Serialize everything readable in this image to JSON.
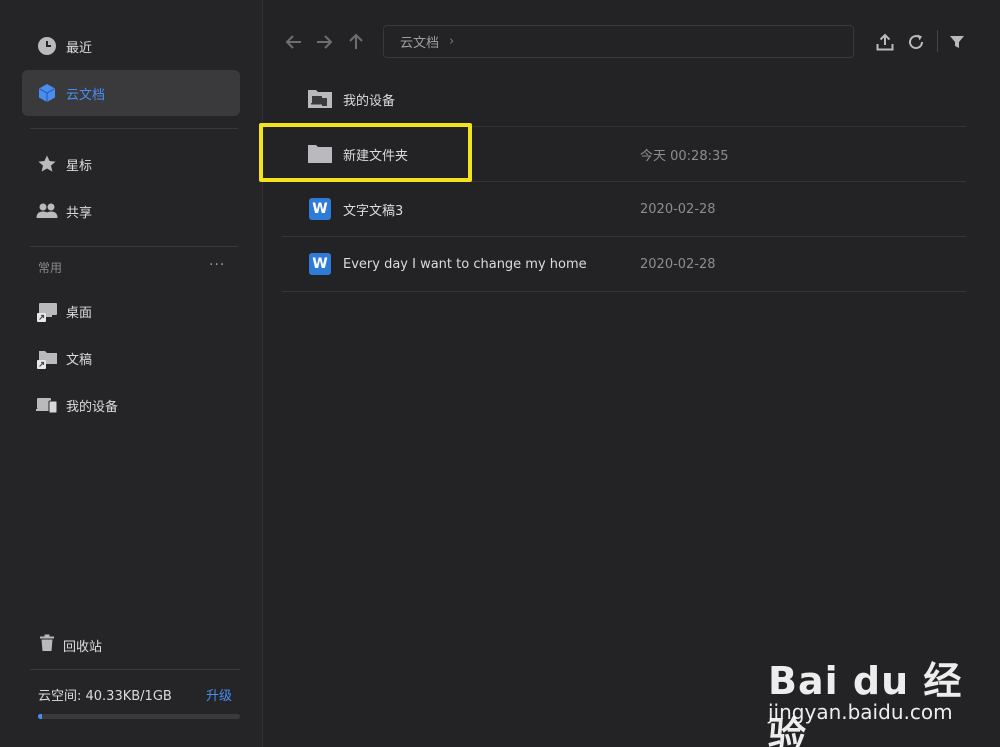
{
  "sidebar": {
    "nav": [
      {
        "label": "最近",
        "icon": "clock-icon"
      },
      {
        "label": "云文档",
        "icon": "cube-icon",
        "active": true
      },
      {
        "label": "星标",
        "icon": "star-icon"
      },
      {
        "label": "共享",
        "icon": "people-icon"
      }
    ],
    "section_title": "常用",
    "section_more": "···",
    "favorites": [
      {
        "label": "桌面",
        "icon": "desktop-shortcut-icon"
      },
      {
        "label": "文稿",
        "icon": "folder-shortcut-icon"
      },
      {
        "label": "我的设备",
        "icon": "devices-icon"
      }
    ],
    "trash_label": "回收站",
    "storage_text": "云空间: 40.33KB/1GB",
    "upgrade_label": "升级",
    "storage_used_fraction": 0.02
  },
  "toolbar": {
    "breadcrumb": "云文档",
    "breadcrumb_chevron": "›"
  },
  "files": [
    {
      "name": "我的设备",
      "date": "",
      "icon": "devices-folder-icon"
    },
    {
      "name": "新建文件夹",
      "date": "今天 00:28:35",
      "icon": "folder-icon"
    },
    {
      "name": "文字文稿3",
      "date": "2020-02-28",
      "icon": "word-doc-icon"
    },
    {
      "name": "Every day I want to change my home",
      "date": "2020-02-28",
      "icon": "word-doc-icon"
    }
  ],
  "word_icon_letter": "W",
  "watermark": {
    "logo": "Bai du 经验",
    "url": "jingyan.baidu.com"
  },
  "colors": {
    "accent": "#4a8df0",
    "highlight": "#f4e21c",
    "background": "#232325"
  }
}
